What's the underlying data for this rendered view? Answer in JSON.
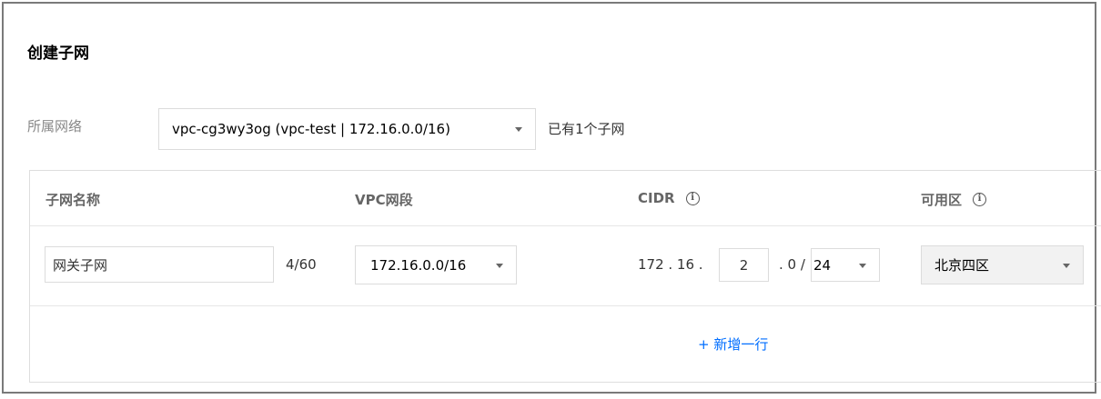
{
  "dialog": {
    "title": "创建子网"
  },
  "vpc": {
    "label": "所属网络",
    "selected": "vpc-cg3wy3og (vpc-test | 172.16.0.0/16)",
    "hint": "已有1个子网"
  },
  "table": {
    "headers": {
      "name": "子网名称",
      "vpc_segment": "VPC网段",
      "cidr": "CIDR",
      "zone": "可用区"
    },
    "row": {
      "name_value": "网关子网",
      "name_counter": "4/60",
      "vpc_segment_selected": "172.16.0.0/16",
      "cidr_prefix": "172 . 16 .",
      "cidr_third_octet": "2",
      "cidr_suffix": ". 0 /",
      "cidr_mask_selected": "24",
      "zone_selected": "北京四区"
    },
    "add_row_label": "+ 新增一行"
  },
  "icons": {
    "info": "info-circle-icon",
    "dropdown": "caret-down-icon"
  },
  "colors": {
    "link": "#006eff",
    "muted_label": "#888888",
    "border": "#dcdcdc",
    "disabled_bg": "#f2f2f2"
  }
}
